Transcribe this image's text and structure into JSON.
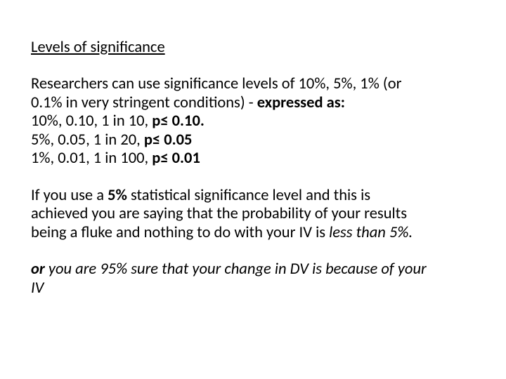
{
  "title": "Levels of significance",
  "intro_a": "Researchers can use significance levels of 10%, 5%, 1% (or",
  "intro_b": "0.1% in very stringent conditions) - ",
  "intro_c": "expressed as:",
  "l10_a": "10%, 0.10, 1 in 10, ",
  "l10_b": "p≤ 0.10.",
  "l5_a": "5%, 0.05, 1 in 20, ",
  "l5_b": "p≤ 0.05",
  "l1_a": "1%, 0.01, 1 in 100, ",
  "l1_b": "p≤ 0.01",
  "p1_a": "If you use a ",
  "p1_b": "5%",
  "p1_c": " statistical significance level and this is",
  "p1_d": "achieved you are saying that the probability of your results",
  "p1_e": "being a fluke and nothing to do with your IV is ",
  "p1_f": "less than 5%.",
  "p2_a": "or",
  "p2_b": " you are 95% sure that your change in DV is because of your",
  "p2_c": "IV"
}
